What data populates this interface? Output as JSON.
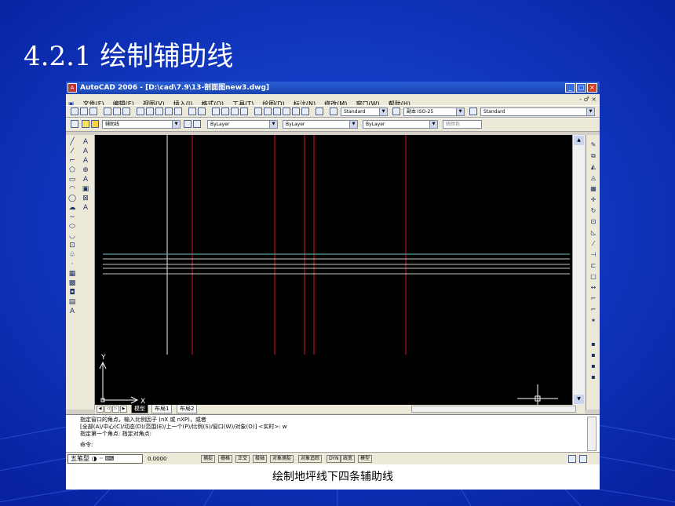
{
  "slide": {
    "title": "4.2.1 绘制辅助线",
    "caption": "绘制地坪线下四条辅助线"
  },
  "colors": {
    "slide_bg": "#0a2fbf",
    "canvas_bg": "#000000",
    "line_white": "#c8c8c8",
    "line_red": "#b4141e",
    "line_cyan": "#5aa0a0"
  },
  "window": {
    "title": "AutoCAD 2006 - [D:\\cad\\7.9\\13-剖面图new3.dwg]",
    "menu": [
      "文件(F)",
      "编辑(E)",
      "视图(V)",
      "插入(I)",
      "格式(O)",
      "工具(T)",
      "绘图(D)",
      "标注(N)",
      "修改(M)",
      "窗口(W)",
      "帮助(H)"
    ],
    "mdi_controls": "- ♂ ×"
  },
  "toolbars": {
    "text_style": "Standard",
    "dim_style": "副本 ISO-25",
    "table_style": "Standard",
    "layer": "辅助线",
    "color": "ByLayer",
    "linetype": "ByLayer",
    "lineweight": "ByLayer",
    "plotstyle": "随颜色"
  },
  "tabs": [
    "模型",
    "布局1",
    "布局2"
  ],
  "command": {
    "lines": [
      "指定窗口的角点，输入比例因子 (nX 或 nXP)，或者",
      "[全部(A)/中心(C)/动态(D)/范围(E)/上一个(P)/比例(S)/窗口(W)/对象(O)] <实时>: w",
      "指定第一个角点: 指定对角点:"
    ],
    "prompt": "命令:"
  },
  "status": {
    "ime": "五笔型",
    "coords": "0.0000",
    "buttons": [
      "捕捉",
      "栅格",
      "正交",
      "极轴",
      "对象捕捉",
      "对象追踪",
      "DYN",
      "线宽",
      "模型"
    ]
  },
  "ucs": {
    "x_label": "X",
    "y_label": "Y"
  }
}
